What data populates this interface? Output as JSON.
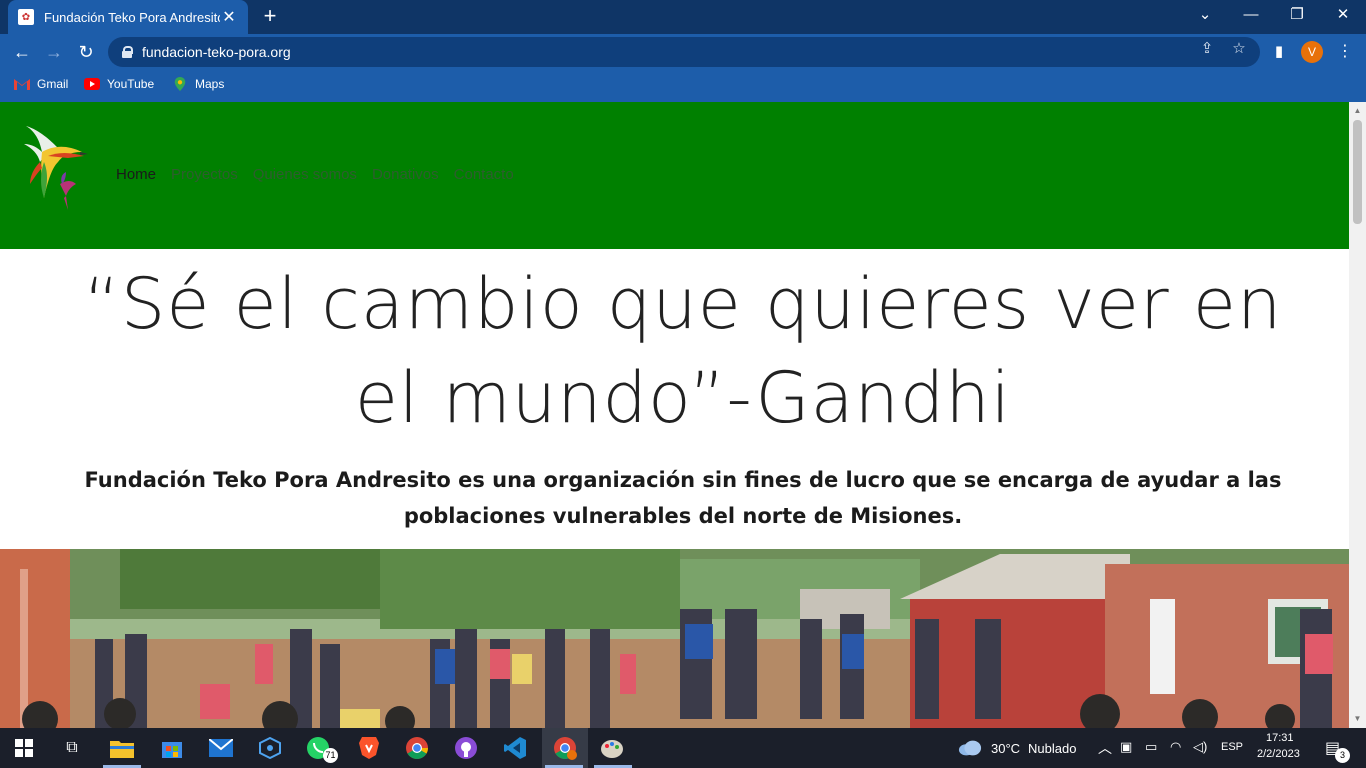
{
  "browser": {
    "tab_title": "Fundación Teko Pora Andresito",
    "tab_close_icon": "close-icon",
    "new_tab_icon": "plus-icon",
    "url": "fundacion-teko-pora.org",
    "profile_initial": "V",
    "bookmarks": [
      {
        "label": "Gmail",
        "icon": "gmail-icon",
        "color": "#ea4335"
      },
      {
        "label": "YouTube",
        "icon": "youtube-icon",
        "color": "#ff0000"
      },
      {
        "label": "Maps",
        "icon": "maps-icon",
        "color": "#34a853"
      }
    ]
  },
  "site": {
    "header_color": "#008000",
    "nav": [
      "Home",
      "Proyectos",
      "Quienes somos",
      "Donativos",
      "Contacto"
    ],
    "quote": "“Sé el cambio que quieres ver en el mundo”-Gandhi",
    "mission": "Fundación Teko Pora Andresito es una organización sin fines de lucro que se encarga de ayudar a las poblaciones vulnerables del norte de Misiones."
  },
  "taskbar": {
    "weather_temp": "30°C",
    "weather_desc": "Nublado",
    "language": "ESP",
    "time": "17:31",
    "date": "2/2/2023",
    "whatsapp_badge": "71",
    "notification_count": "3"
  }
}
